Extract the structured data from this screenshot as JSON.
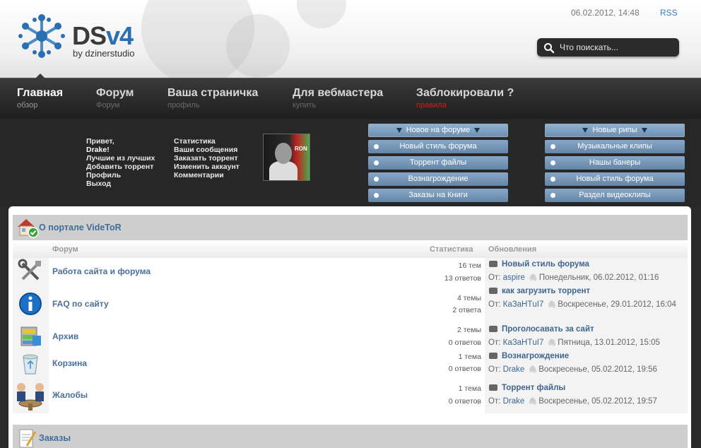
{
  "header": {
    "logo_title_main": "DS",
    "logo_title_accent": "v4",
    "logo_subtitle": "by dzinerstudio",
    "datetime": "06.02.2012, 14:48",
    "rss": "RSS",
    "search_placeholder": "Что поискать..."
  },
  "nav": [
    {
      "title": "Главная",
      "sub": "обзор"
    },
    {
      "title": "Форум",
      "sub": "Форум"
    },
    {
      "title": "Ваша страничка",
      "sub": "профиль"
    },
    {
      "title": "Для вебмастера",
      "sub": "купить"
    },
    {
      "title": "Заблокировали ?",
      "sub": "правила"
    }
  ],
  "user_panel": {
    "greeting_prefix": "Привет,",
    "username": "Drake",
    "greeting_suffix": "!",
    "links_left": [
      "Лучшие из лучших",
      "Добавить торрент",
      "Профиль",
      "Выход"
    ],
    "links_right": [
      "Статистика",
      "Ваши сообщения",
      "Заказать торрент",
      "Изменить аккаунт",
      "Комментарии"
    ],
    "avatar_text": "RON"
  },
  "block_new_forum": {
    "title": "Новое на форуме",
    "items": [
      "Новый стиль форума",
      "Торрент файлы",
      "Вознагрождение",
      "Заказы на Книги"
    ]
  },
  "block_new_rips": {
    "title": "Новые рипы",
    "items": [
      "Музыкальные клипы",
      "Нашы банеры",
      "Новый стиль форума",
      "Раздел видеоклипы"
    ]
  },
  "category1": {
    "title": "О портале VideToR",
    "col_forum": "Форум",
    "col_stats": "Статистика",
    "col_updates": "Обновления",
    "forums": [
      {
        "name": "Работа сайта и форума",
        "topics": "16 тем",
        "replies": "13 ответов",
        "last_title": "Новый стиль форума",
        "from": "От:",
        "user": "aspire",
        "date": "Понедельник, 06.02.2012, 01:16"
      },
      {
        "name": "FAQ по сайту",
        "topics": "4 темы",
        "replies": "2 ответа",
        "last_title": "как загрузить торрент",
        "from": "От:",
        "user": "КаЗаНТuI7",
        "date": "Воскресенье, 29.01.2012, 16:04"
      },
      {
        "name": "Архив",
        "topics": "2 темы",
        "replies": "0 ответов",
        "last_title": "Проголосавать за сайт",
        "from": "От:",
        "user": "КаЗаНТuI7",
        "date": "Пятница, 13.01.2012, 15:05"
      },
      {
        "name": "Корзина",
        "topics": "1 тема",
        "replies": "0 ответов",
        "last_title": "Вознагрождение",
        "from": "От:",
        "user": "Drake",
        "date": "Воскресенье, 05.02.2012, 19:56"
      },
      {
        "name": "Жалобы",
        "topics": "1 тема",
        "replies": "0 ответов",
        "last_title": "Торрент файлы",
        "from": "От:",
        "user": "Drake",
        "date": "Воскресенье, 05.02.2012, 19:57"
      }
    ]
  },
  "category2": {
    "title": "Заказы"
  },
  "colors": {
    "accent": "#3e6e98",
    "block_blue": "#7596b8",
    "nav_bg": "#2a2a2a"
  }
}
